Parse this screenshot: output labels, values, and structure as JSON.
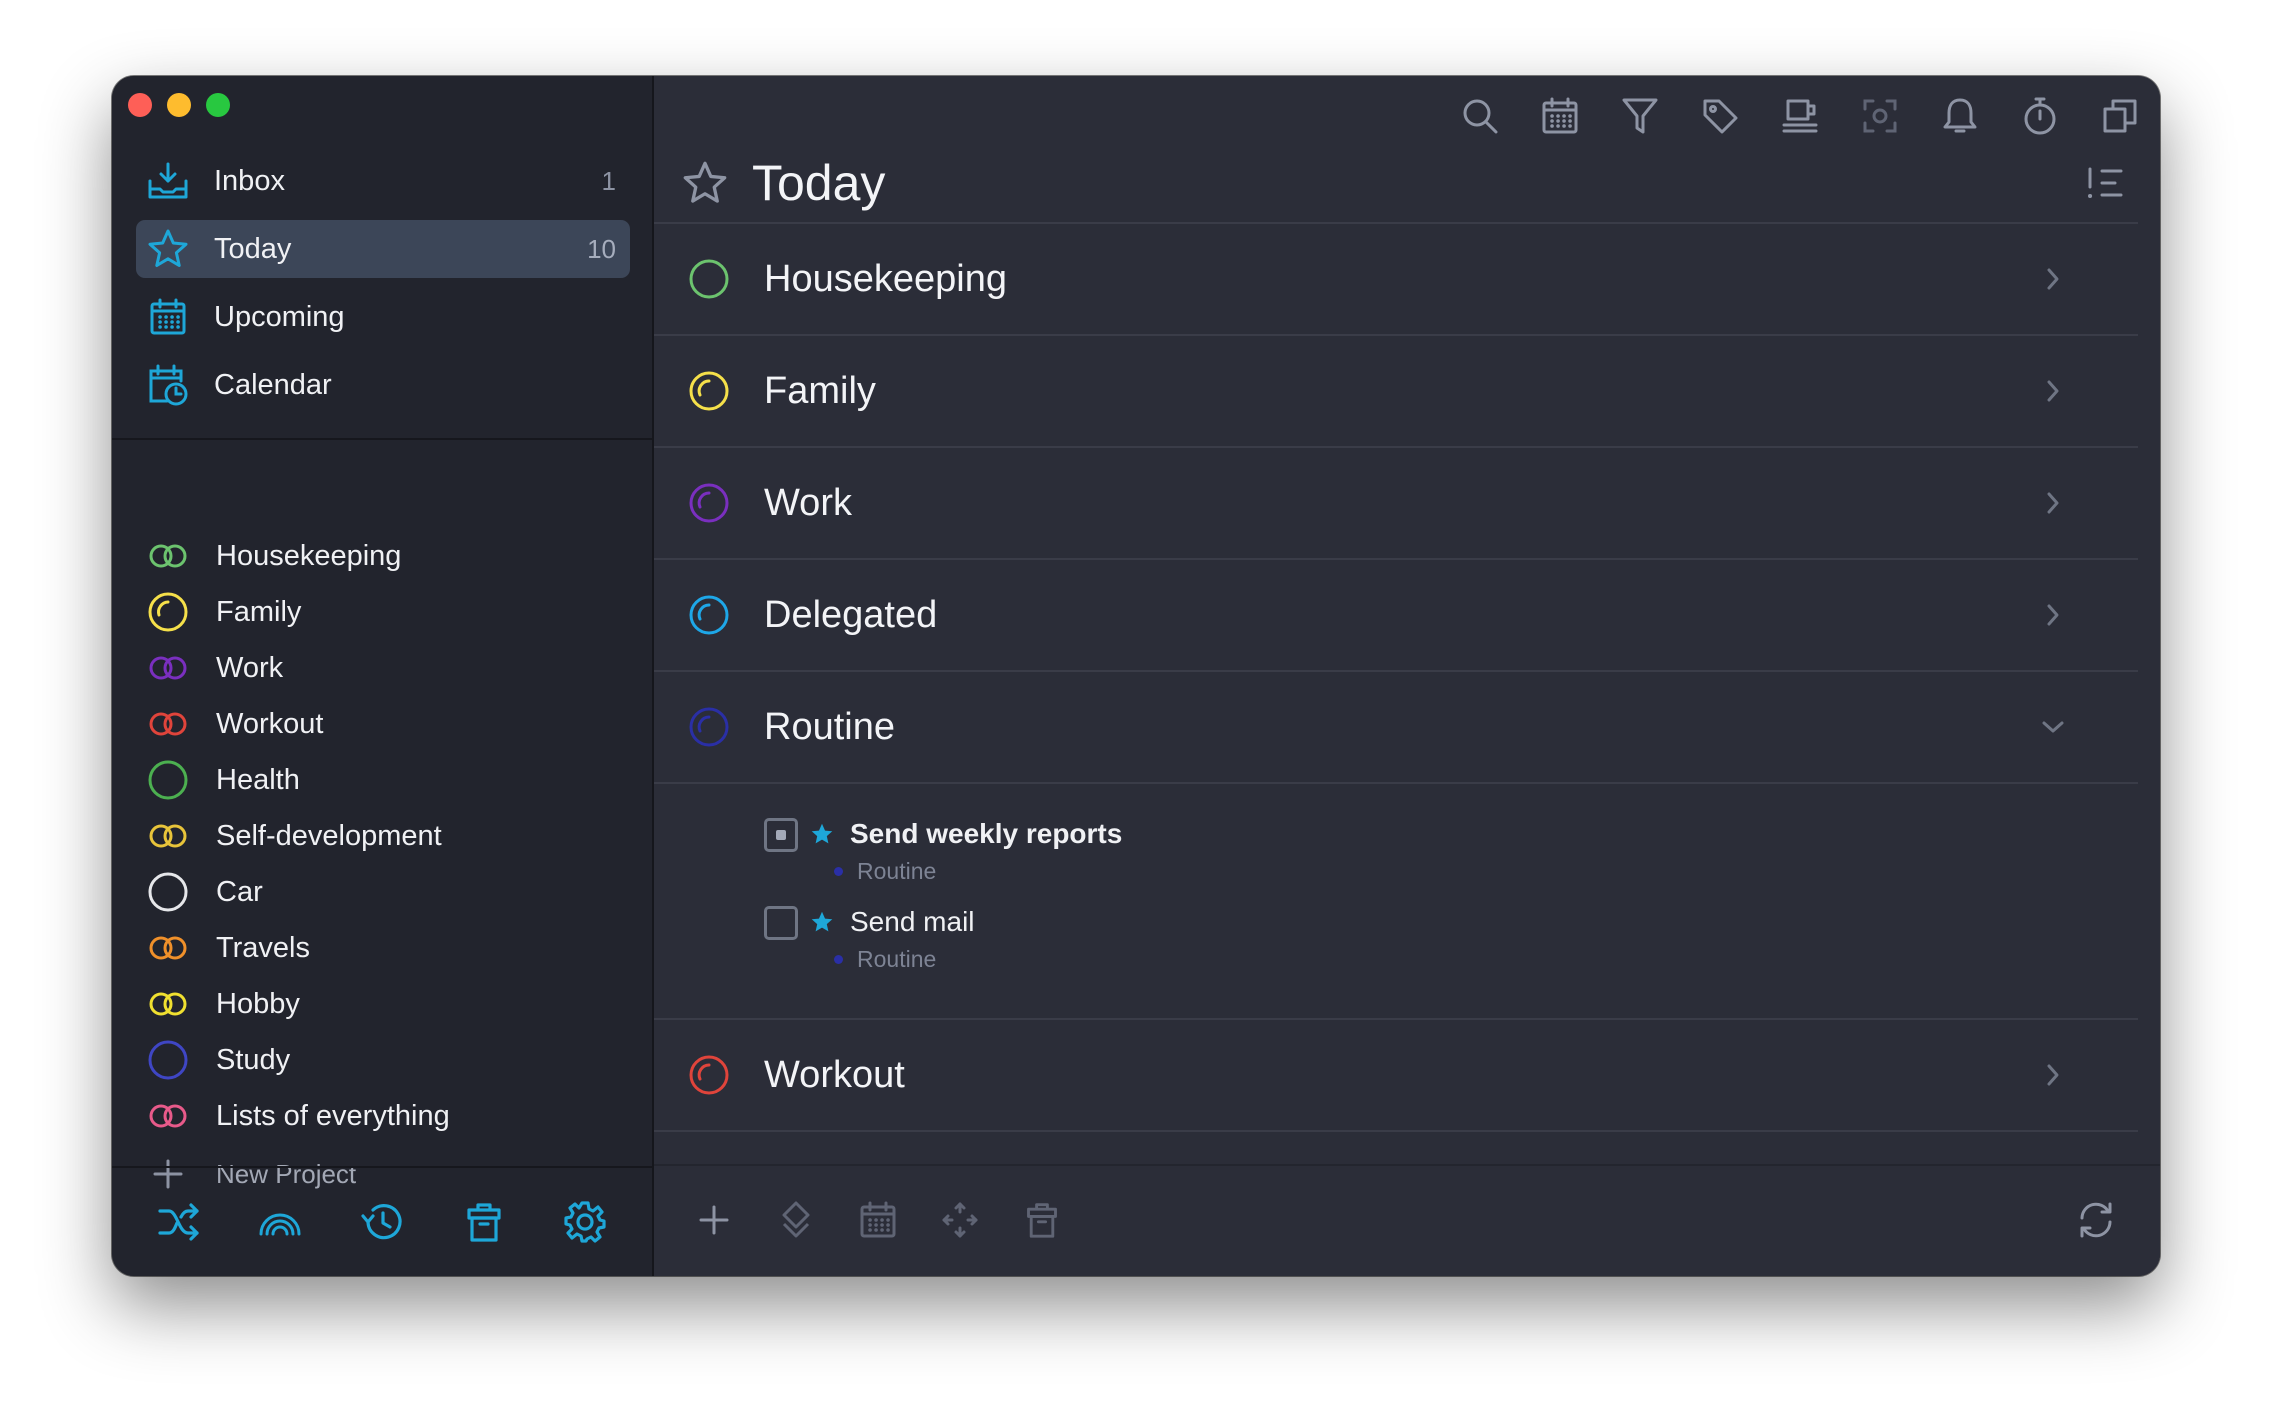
{
  "colors": {
    "accent": "#1ea7d8",
    "sidebar_bg": "#22242d",
    "main_bg": "#2b2d38",
    "active_row": "#3c4658"
  },
  "nav": {
    "inbox": {
      "label": "Inbox",
      "count": "1",
      "icon": "inbox-tray-icon"
    },
    "today": {
      "label": "Today",
      "count": "10",
      "icon": "star-icon"
    },
    "upcoming": {
      "label": "Upcoming",
      "icon": "calendar-grid-icon"
    },
    "calendar": {
      "label": "Calendar",
      "icon": "calendar-clock-icon"
    }
  },
  "projects": [
    {
      "label": "Housekeeping",
      "color": "#6cc36e",
      "icon": "double-ring-icon"
    },
    {
      "label": "Family",
      "color": "#f5e04a",
      "icon": "pie-ring-icon"
    },
    {
      "label": "Work",
      "color": "#7a2fbf",
      "icon": "double-ring-icon"
    },
    {
      "label": "Workout",
      "color": "#e0443b",
      "icon": "double-ring-icon"
    },
    {
      "label": "Health",
      "color": "#4cb050",
      "icon": "ring-icon"
    },
    {
      "label": "Self-development",
      "color": "#e8c43a",
      "icon": "double-ring-icon"
    },
    {
      "label": "Car",
      "color": "#e6e7ea",
      "icon": "ring-icon"
    },
    {
      "label": "Travels",
      "color": "#f0902a",
      "icon": "double-ring-icon"
    },
    {
      "label": "Hobby",
      "color": "#f0e030",
      "icon": "double-ring-icon"
    },
    {
      "label": "Study",
      "color": "#3f46c4",
      "icon": "ring-icon"
    },
    {
      "label": "Lists of everything",
      "color": "#e85a8a",
      "icon": "double-ring-icon"
    }
  ],
  "new_project_label": "New Project",
  "sidebar_footer": [
    "shuffle-icon",
    "rainbow-icon",
    "history-icon",
    "trash-icon",
    "gear-icon"
  ],
  "toolbar": [
    "search-icon",
    "calendar-icon",
    "filter-icon",
    "tag-icon",
    "coffee-cup-icon",
    "focus-icon",
    "bell-icon",
    "timer-icon",
    "duplicate-window-icon"
  ],
  "main": {
    "title": "Today",
    "groups_before": [
      {
        "label": "Housekeeping",
        "color": "#6cc36e"
      },
      {
        "label": "Family",
        "color": "#f5e04a"
      },
      {
        "label": "Work",
        "color": "#7a2fbf"
      },
      {
        "label": "Delegated",
        "color": "#1ea7e8"
      }
    ],
    "expanded_group": {
      "label": "Routine",
      "color": "#2a2fa6"
    },
    "tasks": [
      {
        "title": "Send weekly reports",
        "project": "Routine",
        "bold": true,
        "checkbox_marked": true
      },
      {
        "title": "Send mail",
        "project": "Routine",
        "bold": false,
        "checkbox_marked": false
      }
    ],
    "groups_after": [
      {
        "label": "Workout",
        "color": "#e0443b"
      }
    ]
  },
  "main_footer": [
    "add-icon",
    "priority-icon",
    "calendar-icon",
    "move-icon",
    "trash-icon",
    "sync-icon"
  ]
}
